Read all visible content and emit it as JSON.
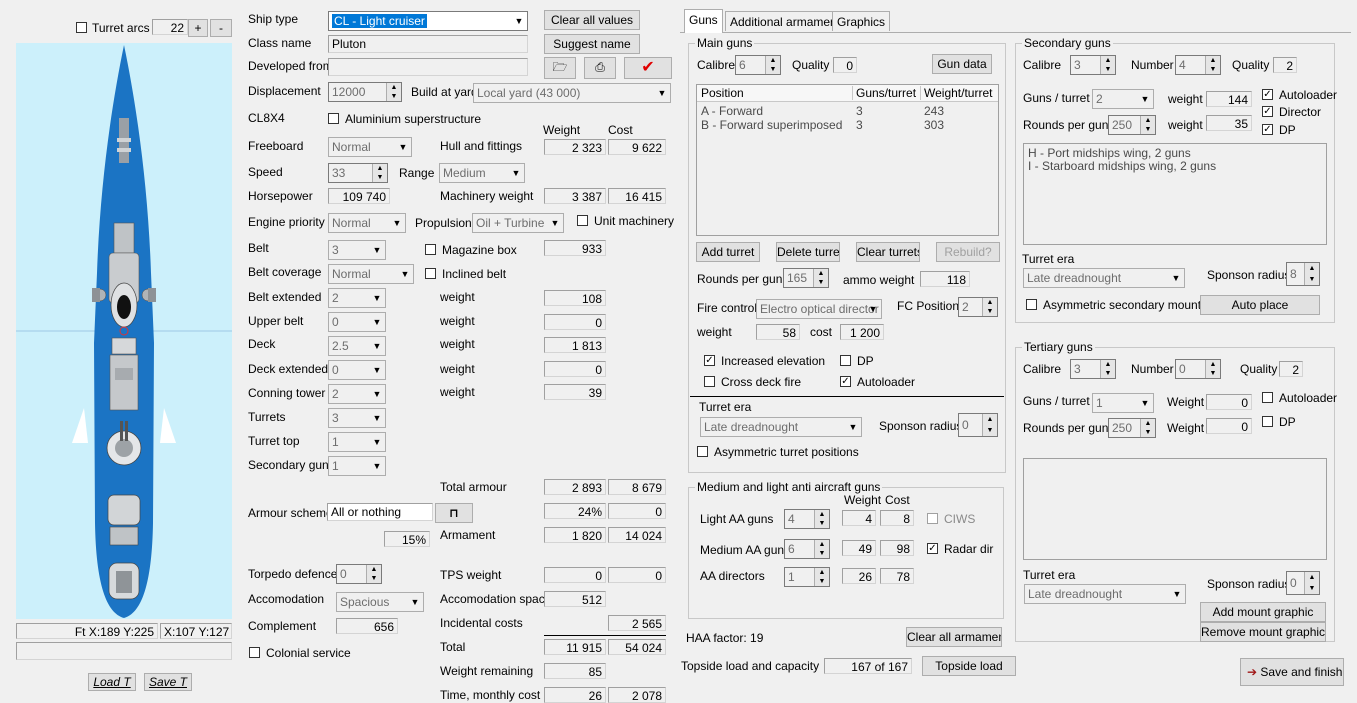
{
  "left": {
    "turret_arcs": "Turret arcs",
    "arc_value": "22",
    "plus": "+",
    "minus": "-",
    "coord_left": "Ft X:189 Y:225",
    "coord_right": "X:107 Y:127",
    "load_button": "Load T",
    "save_button": "Save T"
  },
  "general": {
    "ship_type_label": "Ship type",
    "ship_type": "CL - Light cruiser",
    "class_name_label": "Class name",
    "class_name": "Pluton",
    "developed_from_label": "Developed from",
    "clear_all_values": "Clear all values",
    "suggest_name": "Suggest name",
    "checkmark": "✔",
    "displacement_label": "Displacement",
    "displacement": "12000",
    "build_at_yard_label": "Build at yard",
    "build_at_yard": "Local yard (43 000)",
    "hull_code": "CL8X4",
    "aluminium": "Aluminium superstructure",
    "weight_header": "Weight",
    "cost_header": "Cost",
    "freeboard_label": "Freeboard",
    "freeboard": "Normal",
    "hull_fittings_label": "Hull and fittings",
    "hull_weight": "2 323",
    "hull_cost": "9 622",
    "speed_label": "Speed",
    "speed": "33",
    "range_label": "Range",
    "range": "Medium",
    "horsepower_label": "Horsepower",
    "horsepower": "109 740",
    "machinery_label": "Machinery weight",
    "machinery_weight": "3 387",
    "machinery_cost": "16 415",
    "engine_priority_label": "Engine priority",
    "engine_priority": "Normal",
    "propulsion_label": "Propulsion",
    "propulsion": "Oil + Turbine",
    "unit_machinery": "Unit machinery",
    "belt_label": "Belt",
    "belt": "3",
    "magazine_box": "Magazine box",
    "magazine_value": "933",
    "belt_coverage_label": "Belt coverage",
    "belt_coverage": "Normal",
    "inclined_belt": "Inclined belt",
    "belt_extended_label": "Belt extended",
    "belt_extended": "2",
    "belt_extended_weight": "108",
    "upper_belt_label": "Upper belt",
    "upper_belt": "0",
    "upper_belt_weight": "0",
    "deck_label": "Deck",
    "deck": "2.5",
    "deck_weight": "1 813",
    "deck_extended_label": "Deck extended",
    "deck_extended": "0",
    "deck_extended_weight": "0",
    "conning_label": "Conning tower",
    "conning": "2",
    "conning_weight": "39",
    "weight_word": "weight",
    "turrets_label": "Turrets",
    "turrets": "3",
    "turret_top_label": "Turret top",
    "turret_top": "1",
    "secondary_guns_label": "Secondary guns",
    "secondary_guns": "1",
    "total_armour_label": "Total armour",
    "total_armour_weight": "2 893",
    "total_armour_cost": "8 679",
    "armour_scheme_label": "Armour scheme",
    "armour_scheme": "All or nothing",
    "armour_pct": "24%",
    "armour_pct_cost": "0",
    "pct_15": "15%",
    "armament_label": "Armament",
    "armament_weight": "1 820",
    "armament_cost": "14 024",
    "torpedo_label": "Torpedo defence",
    "torpedo": "0",
    "tps_label": "TPS weight",
    "tps_weight": "0",
    "tps_cost": "0",
    "accom_label": "Accomodation",
    "accom": "Spacious",
    "accom_space_label": "Accomodation space",
    "accom_space": "512",
    "complement_label": "Complement",
    "complement": "656",
    "incidental_label": "Incidental costs",
    "incidental": "2 565",
    "colonial": "Colonial service",
    "total_label": "Total",
    "total_weight": "11 915",
    "total_cost": "54 024",
    "weight_remaining_label": "Weight remaining",
    "weight_remaining": "85",
    "time_label": "Time, monthly cost",
    "time": "26",
    "monthly_cost": "2 078"
  },
  "tabs": [
    "Guns",
    "Additional armament",
    "Graphics"
  ],
  "main_guns": {
    "title": "Main guns",
    "calibre_label": "Calibre",
    "calibre": "6",
    "quality_label": "Quality",
    "quality": "0",
    "gun_data": "Gun data",
    "headers": [
      "Position",
      "Guns/turret",
      "Weight/turret"
    ],
    "rows": [
      {
        "pos": "A - Forward",
        "guns": "3",
        "weight": "243"
      },
      {
        "pos": "B - Forward superimposed",
        "guns": "3",
        "weight": "303"
      }
    ],
    "add_turret": "Add turret",
    "delete_turret": "Delete turret",
    "clear_turrets": "Clear turrets",
    "rebuild": "Rebuild?",
    "rounds_label": "Rounds per gun",
    "rounds": "165",
    "ammo_label": "ammo weight",
    "ammo": "118",
    "fire_control_label": "Fire control",
    "fire_control": "Electro optical director",
    "fc_positions_label": "FC Positions",
    "fc_positions": "2",
    "weight_label": "weight",
    "weight": "58",
    "cost_label": "cost",
    "cost": "1 200",
    "increased_elevation": "Increased elevation",
    "dp": "DP",
    "cross_deck": "Cross deck fire",
    "autoloader": "Autoloader",
    "turret_era_label": "Turret era",
    "turret_era": "Late dreadnought",
    "sponson_label": "Sponson radius",
    "sponson": "0",
    "asymmetric": "Asymmetric turret positions"
  },
  "aa": {
    "title": "Medium and light anti aircraft guns",
    "weight_header": "Weight",
    "cost_header": "Cost",
    "light_label": "Light AA guns",
    "light": "4",
    "light_weight": "4",
    "light_cost": "8",
    "ciws": "CIWS",
    "medium_label": "Medium AA guns",
    "medium": "6",
    "medium_weight": "49",
    "medium_cost": "98",
    "radar": "Radar dir",
    "directors_label": "AA directors",
    "directors": "1",
    "directors_weight": "26",
    "directors_cost": "78",
    "haa_factor": "HAA factor: 19",
    "clear_all_armament": "Clear all armament"
  },
  "topside": {
    "label": "Topside load and capacity",
    "value": "167 of 167",
    "button": "Topside load"
  },
  "secondary": {
    "title": "Secondary guns",
    "calibre_label": "Calibre",
    "calibre": "3",
    "number_label": "Number",
    "number": "4",
    "quality_label": "Quality",
    "quality": "2",
    "guns_turret_label": "Guns / turret",
    "guns_turret": "2",
    "weight_label": "weight",
    "weight": "144",
    "autoloader": "Autoloader",
    "rounds_label": "Rounds per gun",
    "rounds": "250",
    "ammo_weight": "35",
    "director": "Director",
    "dp": "DP",
    "mounts": [
      "H - Port midships wing, 2 guns",
      "I - Starboard midships wing, 2 guns"
    ],
    "turret_era_label": "Turret era",
    "turret_era": "Late dreadnought",
    "sponson_label": "Sponson radius",
    "sponson": "8",
    "asymmetric": "Asymmetric secondary mounts",
    "auto_place": "Auto place"
  },
  "tertiary": {
    "title": "Tertiary guns",
    "calibre_label": "Calibre",
    "calibre": "3",
    "number_label": "Number",
    "number": "0",
    "quality_label": "Quality",
    "quality": "2",
    "guns_turret_label": "Guns / turret",
    "guns_turret": "1",
    "weight_label": "Weight",
    "weight": "0",
    "autoloader": "Autoloader",
    "rounds_label": "Rounds per gun",
    "rounds": "250",
    "ammo_weight": "0",
    "dp": "DP",
    "turret_era_label": "Turret era",
    "turret_era": "Late dreadnought",
    "sponson_label": "Sponson radius",
    "sponson": "0",
    "add_mount": "Add mount graphic",
    "remove_mount": "Remove mount graphic"
  },
  "save_finish": "Save and finish",
  "colors": {
    "water": "#ccf0fb",
    "hull": "#1b74c4",
    "accent": "#0078d7",
    "check_red": "#e00000"
  }
}
